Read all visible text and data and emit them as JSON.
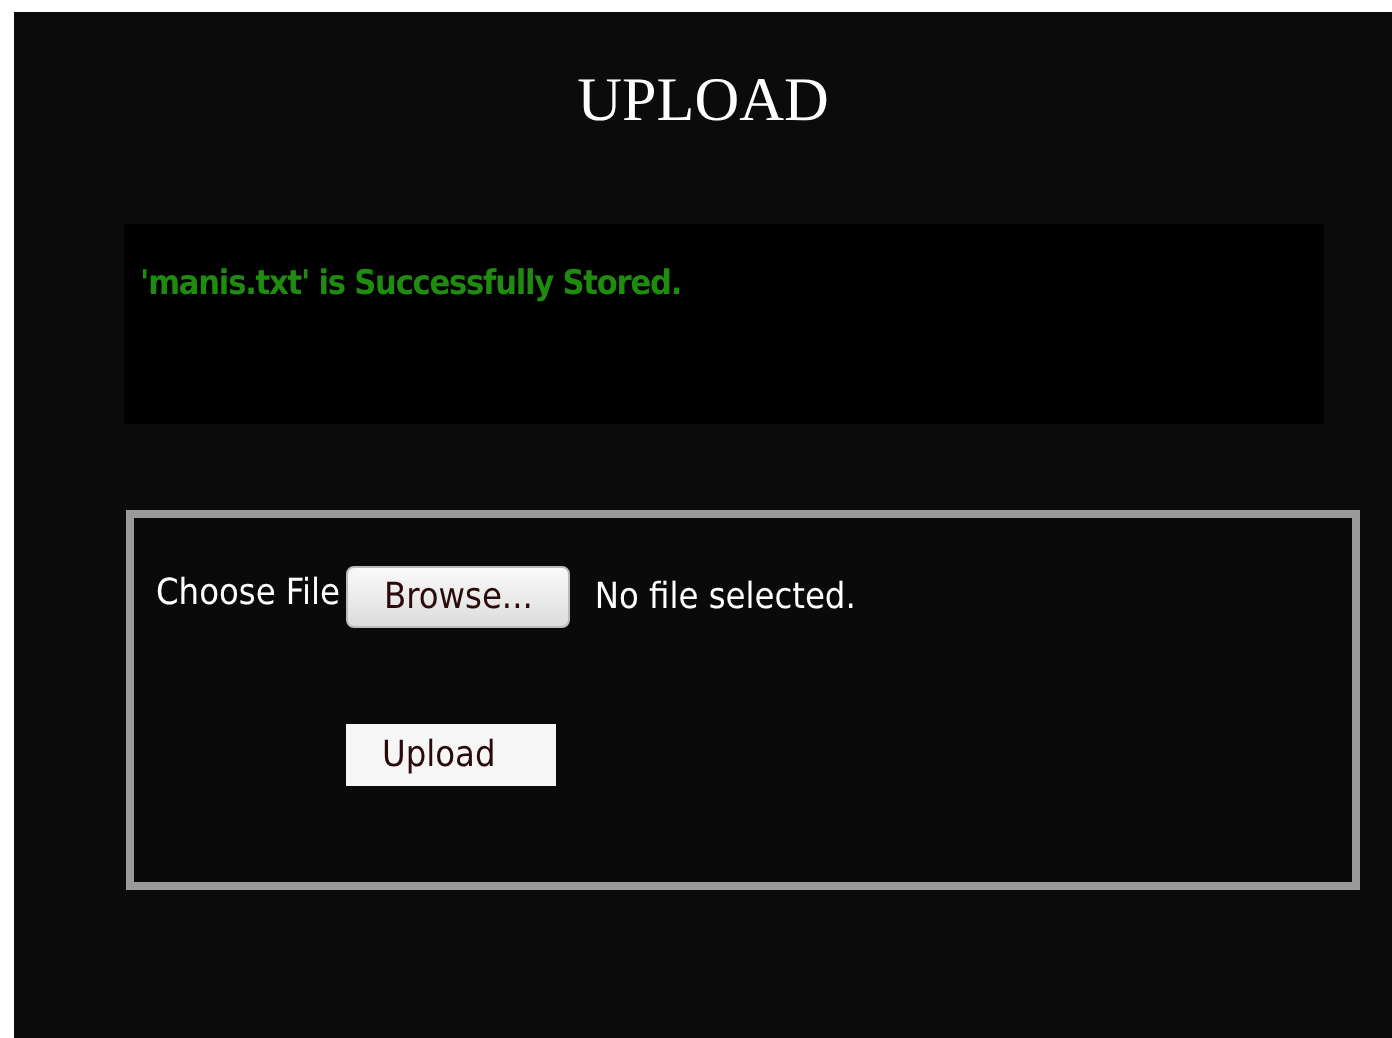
{
  "title": "UPLOAD",
  "message": "'manis.txt' is Successfully Stored.",
  "form": {
    "label": "Choose File",
    "browse_button": "Browse...",
    "file_status": "No file selected.",
    "submit_button": "Upload"
  }
}
